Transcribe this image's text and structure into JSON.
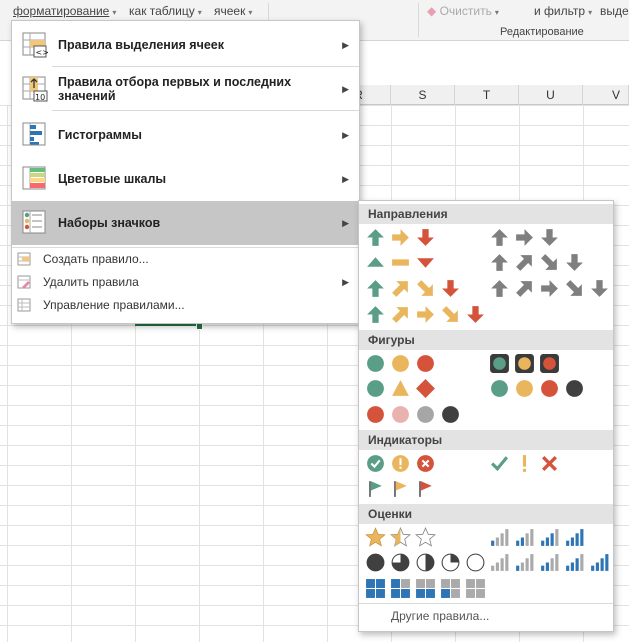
{
  "ribbon": {
    "format_as_table_suffix": "форматирование",
    "as_table": "как таблицу",
    "cells": "ячеек",
    "clear": "Очистить",
    "filter": "и фильтр",
    "select": "выде",
    "group_editing": "Редактирование"
  },
  "columns": [
    "R",
    "S",
    "T",
    "U",
    "V"
  ],
  "menu": {
    "items": [
      {
        "label": "Правила выделения ячеек",
        "icon": "highlight-cells-rules-icon"
      },
      {
        "label": "Правила отбора первых и последних значений",
        "icon": "top-bottom-rules-icon",
        "icon_text": "10"
      },
      {
        "label": "Гистограммы",
        "icon": "data-bars-icon"
      },
      {
        "label": "Цветовые шкалы",
        "icon": "color-scales-icon"
      },
      {
        "label": "Наборы значков",
        "icon": "icon-sets-icon"
      }
    ],
    "small_items": [
      {
        "label": "Создать правило...",
        "icon": "new-rule-icon"
      },
      {
        "label": "Удалить правила",
        "icon": "clear-rules-icon"
      },
      {
        "label": "Управление правилами...",
        "icon": "manage-rules-icon"
      }
    ]
  },
  "submenu": {
    "sections": [
      "Направления",
      "Фигуры",
      "Индикаторы",
      "Оценки"
    ],
    "more_rules": "Другие правила..."
  },
  "colors": {
    "green": "#5a9e87",
    "yellow": "#e9b65e",
    "red": "#d4533a",
    "gray": "#7f7f7f",
    "excel_green": "#217346",
    "highlight": "#c6c6c6"
  }
}
